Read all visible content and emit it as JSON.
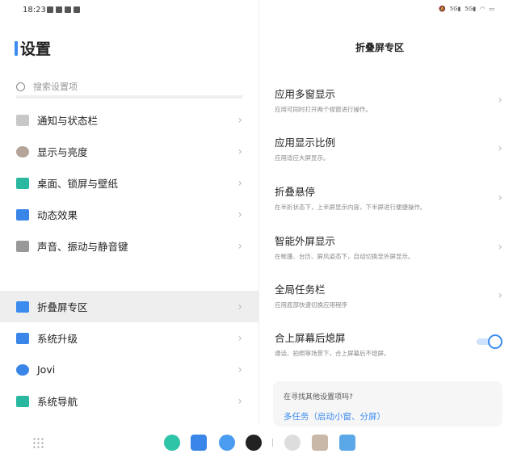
{
  "status": {
    "time": "18:23",
    "right_icons": [
      "mute-icon",
      "speed-icon",
      "5g-signal-icon",
      "5g-signal-icon",
      "wifi-icon",
      "battery-icon"
    ]
  },
  "left": {
    "title": "设置",
    "search_placeholder": "搜索设置项",
    "items": [
      {
        "label": "通知与状态栏",
        "icon": "notification-icon",
        "color": "#c8c8c8"
      },
      {
        "label": "显示与亮度",
        "icon": "display-icon",
        "color": "#b5a49a"
      },
      {
        "label": "桌面、锁屏与壁纸",
        "icon": "wallpaper-icon",
        "color": "#2bb8a0"
      },
      {
        "label": "动态效果",
        "icon": "animation-icon",
        "color": "#3a86e8"
      },
      {
        "label": "声音、振动与静音键",
        "icon": "sound-icon",
        "color": "#999999"
      },
      {
        "label": "折叠屏专区",
        "icon": "fold-icon",
        "color": "#3c8cf0",
        "selected": true
      },
      {
        "label": "系统升级",
        "icon": "upgrade-icon",
        "color": "#3a86e8"
      },
      {
        "label": "Jovi",
        "icon": "jovi-icon",
        "color": "#3a86e8"
      },
      {
        "label": "系统导航",
        "icon": "navigation-icon",
        "color": "#2bb8a0"
      }
    ]
  },
  "right": {
    "title": "折叠屏专区",
    "items": [
      {
        "title": "应用多窗显示",
        "sub": "应用可同时打开两个视窗进行操作。"
      },
      {
        "title": "应用显示比例",
        "sub": "应用适应大屏显示。"
      },
      {
        "title": "折叠悬停",
        "sub": "在半折状态下，上半屏显示内容，下半屏进行便捷操作。"
      },
      {
        "title": "智能外屏显示",
        "sub": "在帐篷、台历、屏风姿态下，自动切换至外屏显示。"
      },
      {
        "title": "全局任务栏",
        "sub": "应用底部快速切换应用程序"
      },
      {
        "title": "合上屏幕后熄屏",
        "sub": "通话、拍照等场景下，合上屏幕后不熄屏。",
        "toggle": true
      }
    ],
    "toggle_on": true,
    "card": {
      "question": "在寻找其他设置项吗?",
      "link": "多任务（启动小窗、分屏）"
    }
  },
  "dock": {
    "apps": [
      {
        "name": "phone-app",
        "color": "#2ec4a8"
      },
      {
        "name": "messages-app",
        "color": "#3a86e8"
      },
      {
        "name": "browser-app",
        "color": "#4a9cf0"
      },
      {
        "name": "camera-app",
        "color": "#222222"
      },
      {
        "name": "settings-app",
        "color": "#dddddd"
      },
      {
        "name": "album-app",
        "color": "#c9b8a8"
      },
      {
        "name": "gallery-app",
        "color": "#5aa8e8"
      }
    ]
  }
}
